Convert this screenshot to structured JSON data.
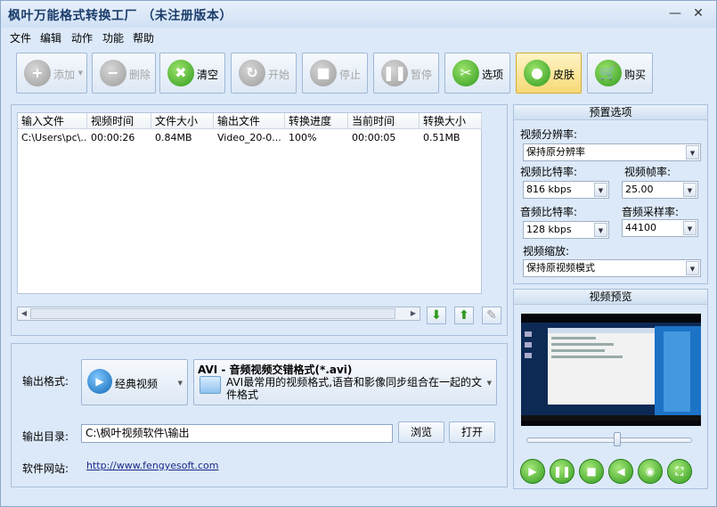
{
  "window": {
    "title": "枫叶万能格式转换工厂 （未注册版本）",
    "minimize": "—",
    "close": "✕"
  },
  "menu": [
    "文件",
    "编辑",
    "动作",
    "功能",
    "帮助"
  ],
  "toolbar": {
    "add": "添加",
    "remove": "删除",
    "clear": "清空",
    "start": "开始",
    "stop": "停止",
    "pause": "暂停",
    "options": "选项",
    "skin": "皮肤",
    "buy": "购买"
  },
  "table": {
    "headers": [
      "输入文件",
      "视频时间",
      "文件大小",
      "输出文件",
      "转换进度",
      "当前时间",
      "转换大小"
    ],
    "rows": [
      [
        "C:\\Users\\pc\\...",
        "00:00:26",
        "0.84MB",
        "Video_20-0...",
        "100%",
        "00:00:05",
        "0.51MB"
      ]
    ]
  },
  "output": {
    "format_label": "输出格式:",
    "format_button": "经典视频",
    "format_title": "AVI - 音频视频交错格式(*.avi)",
    "format_desc": "AVI最常用的视频格式,语音和影像同步组合在一起的文件格式",
    "dir_label": "输出目录:",
    "dir_value": "C:\\枫叶视频软件\\输出",
    "browse": "浏览",
    "open": "打开",
    "website_label": "软件网站:",
    "website": "http://www.fengyesoft.com"
  },
  "preset": {
    "title": "预置选项",
    "resolution_label": "视频分辨率:",
    "resolution": "保持原分辨率",
    "vbitrate_label": "视频比特率:",
    "vbitrate": "816 kbps",
    "fps_label": "视频帧率:",
    "fps": "25.00",
    "abitrate_label": "音频比特率:",
    "abitrate": "128 kbps",
    "samplerate_label": "音频采样率:",
    "samplerate": "44100",
    "zoom_label": "视频缩放:",
    "zoom": "保持原视频模式"
  },
  "preview": {
    "title": "视频预览",
    "seek_fraction": 0.55
  },
  "colors": {
    "accent": "#2f9a1e",
    "panel": "#dce9f8",
    "active": "#f7d977"
  }
}
